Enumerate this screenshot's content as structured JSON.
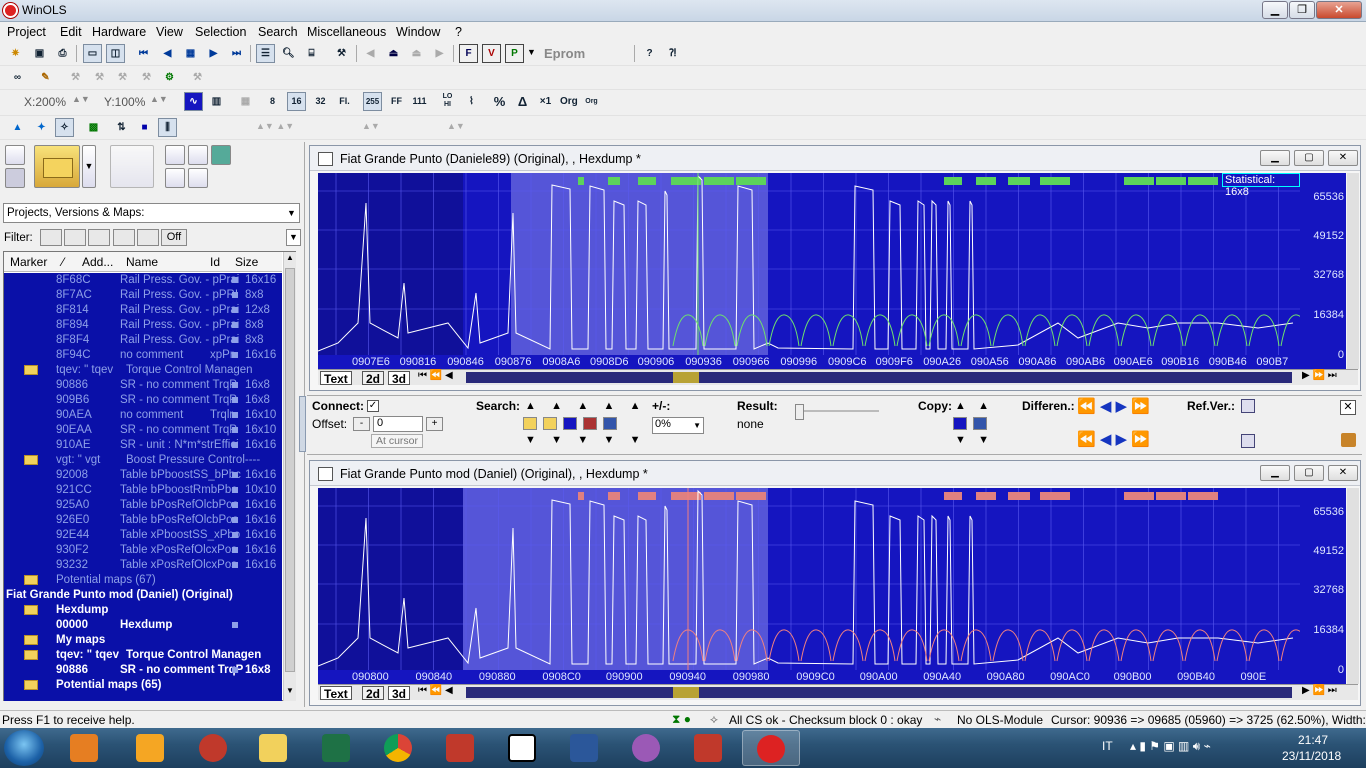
{
  "app": {
    "title": "WinOLS"
  },
  "menu": [
    "Project",
    "Edit",
    "Hardware",
    "View",
    "Selection",
    "Search",
    "Miscellaneous",
    "Window",
    "?"
  ],
  "toolbar": {
    "eprom": "Eprom",
    "zoom_x": "X:200%",
    "zoom_y": "Y:100%",
    "btn_8": "8",
    "btn_16": "16",
    "btn_32": "32",
    "btn_fl": "Fl.",
    "btn_255": "255",
    "btn_ff": "FF",
    "btn_111": "111",
    "btn_lohi": "LO HI",
    "btn_hilo": "HILO",
    "btn_pct": "%",
    "btn_delta": "Δ",
    "btn_x1": "×1",
    "btn_org": "Org"
  },
  "left": {
    "dropdown": "Projects, Versions & Maps:",
    "filter_label": "Filter:",
    "filter_off": "Off",
    "columns": [
      "Marker",
      "⁄",
      "Add...",
      "Name",
      "Id",
      "Size"
    ],
    "rows": [
      {
        "addr": "8F68C",
        "name": "Rail Press. Gov. - pPrai",
        "id": "",
        "size": "16x16",
        "type": "item"
      },
      {
        "addr": "8F7AC",
        "name": "Rail Press. Gov. - pPRI",
        "id": "",
        "size": "8x8",
        "type": "item"
      },
      {
        "addr": "8F814",
        "name": "Rail Press. Gov. - pPrai",
        "id": "",
        "size": "12x8",
        "type": "item"
      },
      {
        "addr": "8F894",
        "name": "Rail Press. Gov. - pPrai",
        "id": "",
        "size": "8x8",
        "type": "item"
      },
      {
        "addr": "8F8F4",
        "name": "Rail Press. Gov. - pPrai",
        "id": "",
        "size": "8x8",
        "type": "item"
      },
      {
        "addr": "8F94C",
        "name": "no comment",
        "id": "xpPr",
        "size": "16x16",
        "type": "item"
      },
      {
        "addr": "tqev: \" tqev",
        "name": "Torque Control Managen",
        "id": "",
        "size": "",
        "type": "folder"
      },
      {
        "addr": "90886",
        "name": "SR - no comment TrqP",
        "id": "",
        "size": "16x8",
        "type": "item"
      },
      {
        "addr": "909B6",
        "name": "SR - no comment TrqP",
        "id": "",
        "size": "16x8",
        "type": "item"
      },
      {
        "addr": "90AEA",
        "name": " no comment",
        "id": "Trqlr",
        "size": "16x10",
        "type": "item"
      },
      {
        "addr": "90EAA",
        "name": "SR - no comment TrqP",
        "id": "",
        "size": "16x10",
        "type": "item"
      },
      {
        "addr": "910AE",
        "name": "SR - unit : N*m*strEffici",
        "id": "",
        "size": "16x16",
        "type": "item"
      },
      {
        "addr": "vgt: \" vgt",
        "name": "Boost Pressure Control----",
        "id": "",
        "size": "",
        "type": "folder"
      },
      {
        "addr": "92008",
        "name": "Table bPboostSS_bPbc",
        "id": "",
        "size": "16x16",
        "type": "item"
      },
      {
        "addr": "921CC",
        "name": "Table bPboostRmbPbc",
        "id": "",
        "size": "10x10",
        "type": "item"
      },
      {
        "addr": "925A0",
        "name": "Table bPosRefOlcbPos",
        "id": "",
        "size": "16x16",
        "type": "item"
      },
      {
        "addr": "926E0",
        "name": "Table bPosRefOlcbPos",
        "id": "",
        "size": "16x16",
        "type": "item"
      },
      {
        "addr": "92E44",
        "name": "Table xPboostSS_xPbo",
        "id": "",
        "size": "16x16",
        "type": "item"
      },
      {
        "addr": "930F2",
        "name": "Table xPosRefOlcxPos",
        "id": "",
        "size": "16x16",
        "type": "item"
      },
      {
        "addr": "93232",
        "name": "Table xPosRefOlcxPos",
        "id": "",
        "size": "16x16",
        "type": "item"
      },
      {
        "addr": "Potential maps (67)",
        "name": "",
        "id": "",
        "size": "",
        "type": "folder"
      },
      {
        "addr": "Fiat Grande Punto mod (Daniel) (Original)",
        "name": "",
        "id": "",
        "size": "",
        "type": "project"
      },
      {
        "addr": "Hexdump",
        "name": "",
        "id": "",
        "size": "",
        "type": "folderbright"
      },
      {
        "addr": "00000",
        "name": "Hexdump",
        "id": "",
        "size": "",
        "type": "itembright"
      },
      {
        "addr": "My maps",
        "name": "",
        "id": "",
        "size": "",
        "type": "folderbright"
      },
      {
        "addr": "tqev: \" tqev",
        "name": "Torque Control Managen",
        "id": "",
        "size": "",
        "type": "folderbright"
      },
      {
        "addr": "90886",
        "name": "SR - no comment TrqP",
        "id": "",
        "size": "16x8",
        "type": "itembright"
      },
      {
        "addr": "Potential maps (65)",
        "name": "",
        "id": "",
        "size": "",
        "type": "folderbright"
      }
    ]
  },
  "win1": {
    "title": "Fiat Grande Punto (Daniele89) (Original), , Hexdump *",
    "tooltip": "Statistical: 16x8",
    "yticks": [
      "65536",
      "49152",
      "32768",
      "16384",
      "0"
    ],
    "xticks": [
      "0907E6",
      "090816",
      "090846",
      "090876",
      "0908A6",
      "0908D6",
      "090906",
      "090936",
      "090966",
      "090996",
      "0909C6",
      "0909F6",
      "090A26",
      "090A56",
      "090A86",
      "090AB6",
      "090AE6",
      "090B16",
      "090B46",
      "090B7"
    ],
    "tabs": [
      "Text",
      "2d",
      "3d"
    ]
  },
  "win2": {
    "title": "Fiat Grande Punto mod (Daniel) (Original), , Hexdump *",
    "yticks": [
      "65536",
      "49152",
      "32768",
      "16384",
      "0"
    ],
    "xticks": [
      "090800",
      "090840",
      "090880",
      "0908C0",
      "090900",
      "090940",
      "090980",
      "0909C0",
      "090A00",
      "090A40",
      "090A80",
      "090AC0",
      "090B00",
      "090B40",
      "090E"
    ],
    "tabs": [
      "Text",
      "2d",
      "3d"
    ]
  },
  "mid": {
    "connect": "Connect:",
    "offset": "Offset:",
    "offset_val": "0",
    "at_cursor": "At cursor",
    "search": "Search:",
    "plusminus": "+/-:",
    "pct": "0%",
    "result": "Result:",
    "result_val": "none",
    "copy": "Copy:",
    "differen": "Differen.:",
    "refver": "Ref.Ver.:"
  },
  "status": {
    "help": "Press F1 to receive help.",
    "checksum": "All CS ok - Checksum block 0 : okay",
    "ols": "No OLS-Module",
    "cursor": "Cursor: 90936 => 09685 (05960) => 3725 (62.50%), Width: 16"
  },
  "tray": {
    "lang": "IT",
    "time": "21:47",
    "date": "23/11/2018"
  }
}
